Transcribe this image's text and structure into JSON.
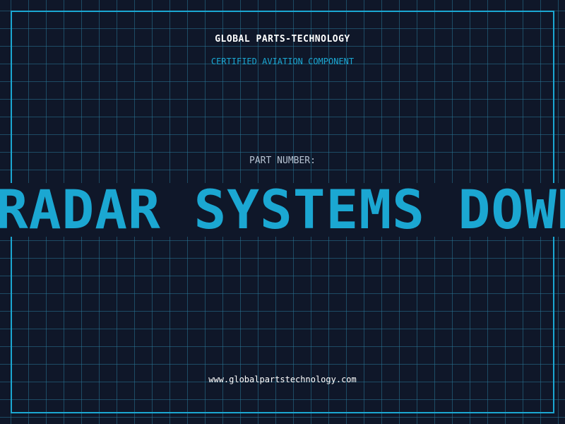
{
  "brand": {
    "title": "GLOBAL PARTS-TECHNOLOGY",
    "subtitle": "CERTIFIED AVIATION COMPONENT"
  },
  "part": {
    "label": "PART NUMBER:",
    "value": "RADAR SYSTEMS DOWN"
  },
  "footer": {
    "website": "www.globalpartstechnology.com"
  },
  "colors": {
    "background": "#0f1729",
    "accent": "#1ba7d2",
    "grid": "#287696",
    "text": "#ffffff",
    "muted": "#b7c3d2"
  }
}
